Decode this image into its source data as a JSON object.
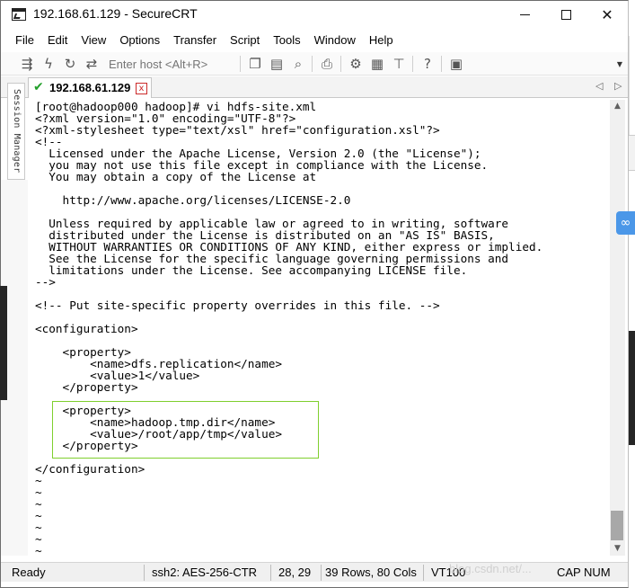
{
  "window": {
    "title": "192.168.61.129 - SecureCRT"
  },
  "menu": [
    "File",
    "Edit",
    "View",
    "Options",
    "Transfer",
    "Script",
    "Tools",
    "Window",
    "Help"
  ],
  "toolbar": {
    "host_placeholder": "Enter host <Alt+R>"
  },
  "tab": {
    "label": "192.168.61.129",
    "close": "x"
  },
  "session_manager": {
    "label": "Session Manager"
  },
  "terminal": {
    "lines": [
      "[root@hadoop000 hadoop]# vi hdfs-site.xml",
      "<?xml version=\"1.0\" encoding=\"UTF-8\"?>",
      "<?xml-stylesheet type=\"text/xsl\" href=\"configuration.xsl\"?>",
      "<!--",
      "  Licensed under the Apache License, Version 2.0 (the \"License\");",
      "  you may not use this file except in compliance with the License.",
      "  You may obtain a copy of the License at",
      "",
      "    http://www.apache.org/licenses/LICENSE-2.0",
      "",
      "  Unless required by applicable law or agreed to in writing, software",
      "  distributed under the License is distributed on an \"AS IS\" BASIS,",
      "  WITHOUT WARRANTIES OR CONDITIONS OF ANY KIND, either express or implied.",
      "  See the License for the specific language governing permissions and",
      "  limitations under the License. See accompanying LICENSE file.",
      "-->",
      "",
      "<!-- Put site-specific property overrides in this file. -->",
      "",
      "<configuration>",
      "",
      "    <property>",
      "        <name>dfs.replication</name>",
      "        <value>1</value>",
      "    </property>",
      "",
      "    <property>",
      "        <name>hadoop.tmp.dir</name>",
      "        <value>/root/app/tmp</value>",
      "    </property>",
      "",
      "</configuration>",
      "~",
      "~",
      "~",
      "~",
      "~",
      "~",
      "~"
    ]
  },
  "status": {
    "ready": "Ready",
    "cipher": "ssh2: AES-256-CTR",
    "cursor": "28, 29",
    "size": "39 Rows, 80 Cols",
    "emulation": "VT100",
    "cap": "CAP",
    "num": "NUM"
  },
  "watermark": "blog.csdn.net/..."
}
